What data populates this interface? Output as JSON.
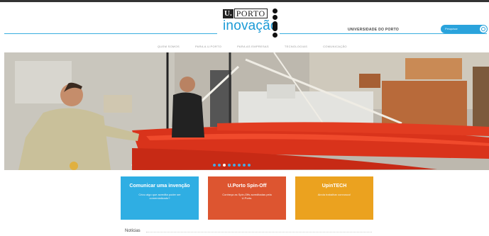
{
  "logo": {
    "u": "U.",
    "porto": "PORTO",
    "inovacao": "inovação"
  },
  "header": {
    "university": "UNIVERSIDADE DO PORTO",
    "search_placeholder": "Pesquisar"
  },
  "nav": [
    "QUEM SOMOS",
    "PARA A U.PORTO",
    "PARA AS EMPRESAS",
    "TECNOLOGIAS",
    "COMUNICAÇÃO"
  ],
  "hero": {
    "slide_count": 8,
    "active_slide": 3
  },
  "tiles": [
    {
      "title": "Comunicar uma invenção",
      "text": "Criou algo que acredita poder ser comercializado?"
    },
    {
      "title": "U.Porto Spin-Off",
      "text": "Conheça as Spin-Offs acreditadas pela U.Porto."
    },
    {
      "title": "UpinTECH",
      "text": "Ainda trabalhar connosco!"
    }
  ],
  "news": {
    "heading": "Notícias"
  },
  "colors": {
    "brand_blue": "#2faee3",
    "spinoff_orange": "#dd5530",
    "upintech_yellow": "#eba21f"
  }
}
